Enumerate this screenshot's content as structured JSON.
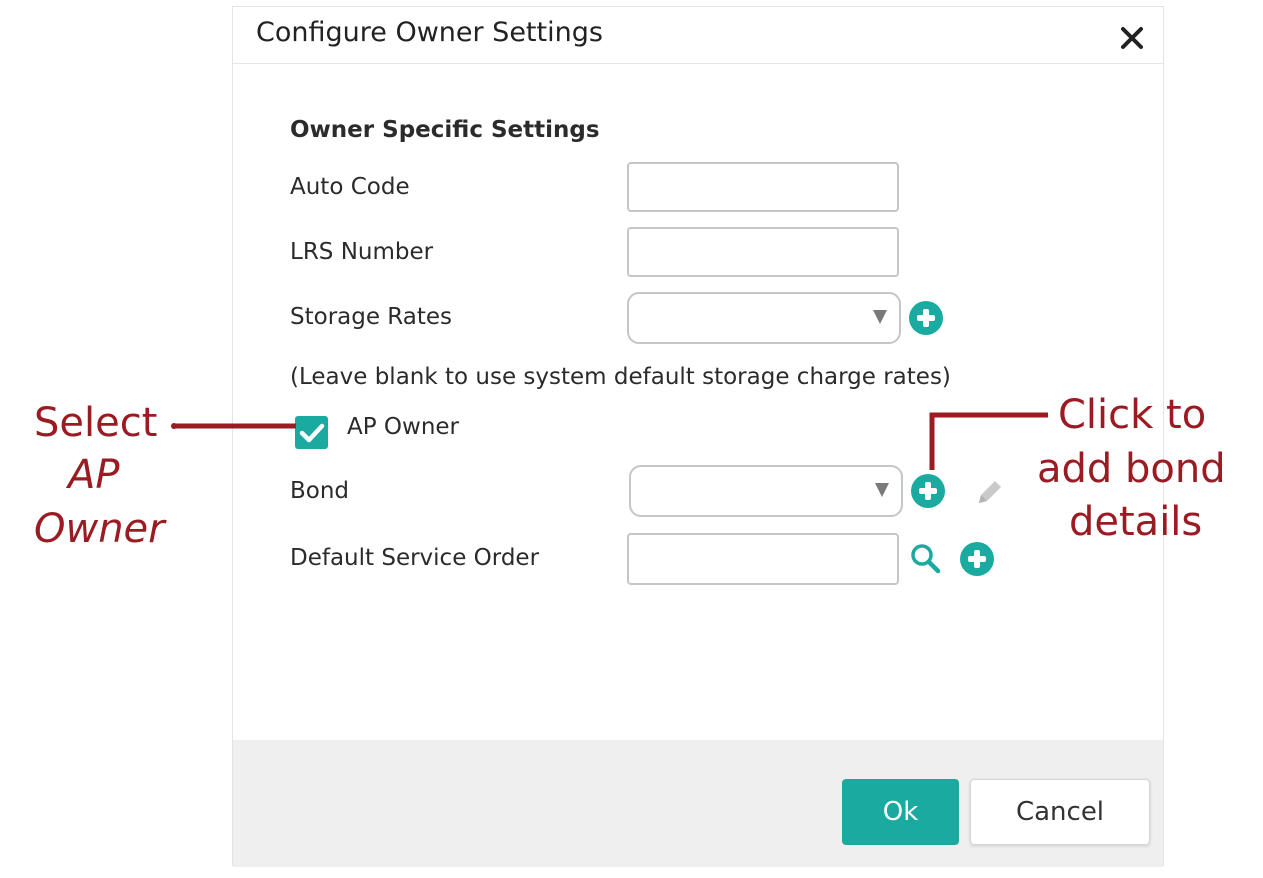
{
  "dialog": {
    "title": "Configure Owner Settings",
    "close_icon": "close-icon",
    "section_title": "Owner Specific Settings",
    "fields": {
      "auto_code": {
        "label": "Auto Code",
        "value": ""
      },
      "lrs_number": {
        "label": "LRS Number",
        "value": ""
      },
      "storage_rates": {
        "label": "Storage Rates",
        "selected": ""
      },
      "storage_hint": "(Leave blank to use system default storage charge rates)",
      "ap_owner": {
        "label": "AP Owner",
        "checked": true
      },
      "bond": {
        "label": "Bond",
        "selected": ""
      },
      "default_service_order": {
        "label": "Default Service Order",
        "value": ""
      }
    },
    "buttons": {
      "ok": "Ok",
      "cancel": "Cancel"
    }
  },
  "annotations": {
    "left": {
      "line1": "Select",
      "line2": "AP",
      "line3": "Owner"
    },
    "right": {
      "line1": "Click to",
      "line2": "add bond",
      "line3": "details"
    }
  },
  "colors": {
    "accent": "#1aaa9f",
    "annotation": "#9b1b22",
    "footer_bg": "#efefef"
  },
  "icons": [
    "close-icon",
    "plus-circle-icon",
    "search-icon",
    "pencil-icon",
    "chevron-down-icon",
    "check-icon"
  ]
}
